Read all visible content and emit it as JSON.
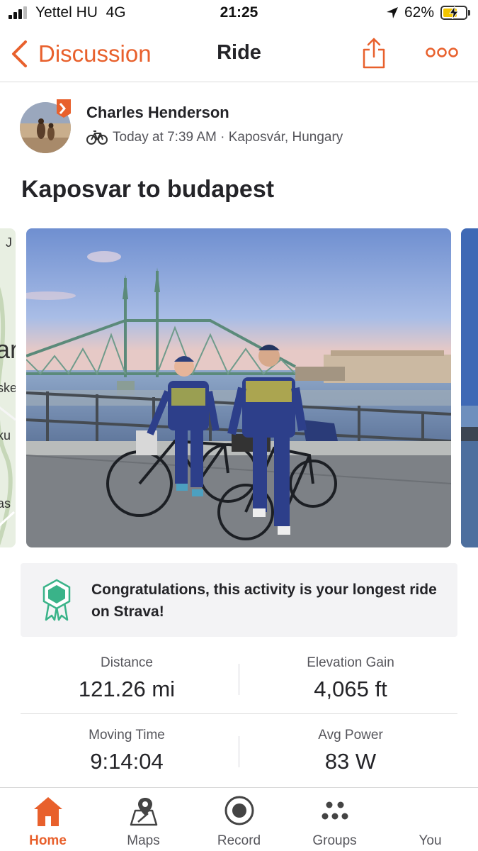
{
  "status_bar": {
    "carrier": "Yettel HU",
    "network": "4G",
    "time": "21:25",
    "battery": "62%",
    "battery_level": 0.62
  },
  "nav": {
    "back_label": "Discussion",
    "title": "Ride",
    "share_icon": "share-icon",
    "more_icon": "more-dots-icon"
  },
  "activity": {
    "athlete_name": "Charles Henderson",
    "activity_icon": "bike-icon",
    "meta": "Today at 7:39 AM · Kaposvár, Hungary",
    "title": "Kaposvar to budapest"
  },
  "map_peek": {
    "labels": [
      "J",
      "ar",
      "ske",
      "ku",
      "as"
    ]
  },
  "achievement": {
    "icon": "award-badge-icon",
    "text": "Congratulations, this activity is your longest ride on Strava!"
  },
  "stats": [
    {
      "label": "Distance",
      "value": "121.26 mi"
    },
    {
      "label": "Elevation Gain",
      "value": "4,065 ft"
    },
    {
      "label": "Moving Time",
      "value": "9:14:04"
    },
    {
      "label": "Avg Power",
      "value": "83 W"
    }
  ],
  "tabs": [
    {
      "label": "Home",
      "icon": "home-icon",
      "active": true
    },
    {
      "label": "Maps",
      "icon": "maps-icon",
      "active": false
    },
    {
      "label": "Record",
      "icon": "record-icon",
      "active": false
    },
    {
      "label": "Groups",
      "icon": "groups-icon",
      "active": false
    },
    {
      "label": "You",
      "icon": "avatar",
      "active": false
    }
  ],
  "colors": {
    "accent": "#e8602c",
    "text": "#242428",
    "secondary_text": "#55555b",
    "achievement_bg": "#f3f3f5",
    "badge_green": "#3ab389"
  }
}
